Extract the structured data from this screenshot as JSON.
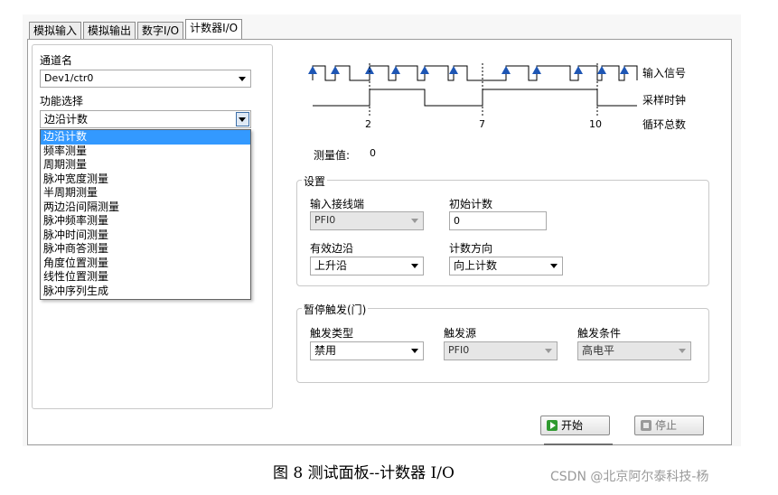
{
  "tabs": [
    {
      "label": "模拟输入",
      "active": false
    },
    {
      "label": "模拟输出",
      "active": false
    },
    {
      "label": "数字I/O",
      "active": false
    },
    {
      "label": "计数器I/O",
      "active": true
    }
  ],
  "left": {
    "channel_label": "通道名",
    "channel_value": "Dev1/ctr0",
    "function_label": "功能选择",
    "function_value": "边沿计数",
    "function_options": [
      "边沿计数",
      "频率测量",
      "周期测量",
      "脉冲宽度测量",
      "半周期测量",
      "两边沿间隔测量",
      "脉冲频率测量",
      "脉冲时间测量",
      "脉冲商答测量",
      "角度位置测量",
      "线性位置测量",
      "脉冲序列生成"
    ]
  },
  "diagram": {
    "labels": [
      "输入信号",
      "采样时钟",
      "循环总数"
    ],
    "ticks": [
      "2",
      "7",
      "10"
    ]
  },
  "measure": {
    "label": "测量值:",
    "value": "0"
  },
  "settings": {
    "title": "设置",
    "input_terminal_label": "输入接线端",
    "input_terminal_value": "PFI0",
    "initial_count_label": "初始计数",
    "initial_count_value": "0",
    "active_edge_label": "有效边沿",
    "active_edge_value": "上升沿",
    "count_direction_label": "计数方向",
    "count_direction_value": "向上计数"
  },
  "trigger": {
    "title": "暂停触发(门)",
    "type_label": "触发类型",
    "type_value": "禁用",
    "source_label": "触发源",
    "source_value": "PFI0",
    "condition_label": "触发条件",
    "condition_value": "高电平"
  },
  "buttons": {
    "start": "开始",
    "stop": "停止"
  },
  "caption": "图 8  测试面板--计数器 I/O",
  "watermark": "CSDN @北京阿尔泰科技-杨",
  "colors": {
    "selection": "#3399ff",
    "arrow": "#1e56b4",
    "start_icon": "#2f9a2f"
  },
  "icons": {
    "start": "play-icon",
    "stop": "stop-icon"
  }
}
